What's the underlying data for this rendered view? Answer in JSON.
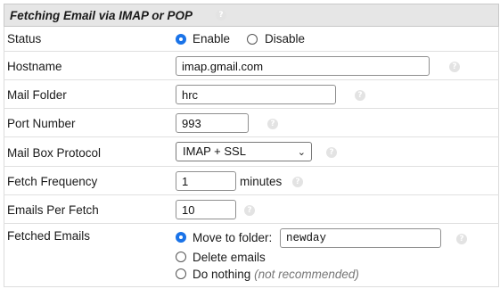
{
  "section": {
    "title": "Fetching Email via IMAP or POP",
    "help_icon": "question-circle-icon"
  },
  "status": {
    "label": "Status",
    "options": [
      {
        "label": "Enable",
        "checked": true
      },
      {
        "label": "Disable",
        "checked": false
      }
    ]
  },
  "hostname": {
    "label": "Hostname",
    "value": "imap.gmail.com"
  },
  "mail_folder": {
    "label": "Mail Folder",
    "value": "hrc"
  },
  "port_number": {
    "label": "Port Number",
    "value": "993"
  },
  "protocol": {
    "label": "Mail Box Protocol",
    "selected": "IMAP + SSL"
  },
  "fetch_frequency": {
    "label": "Fetch Frequency",
    "value": "1",
    "unit": "minutes"
  },
  "emails_per_fetch": {
    "label": "Emails Per Fetch",
    "value": "10"
  },
  "fetched_emails": {
    "label": "Fetched Emails",
    "move_label": "Move to folder:",
    "move_folder": "newday",
    "delete_label": "Delete emails",
    "nothing_label": "Do nothing",
    "nothing_note": "(not recommended)",
    "selected": "move"
  }
}
